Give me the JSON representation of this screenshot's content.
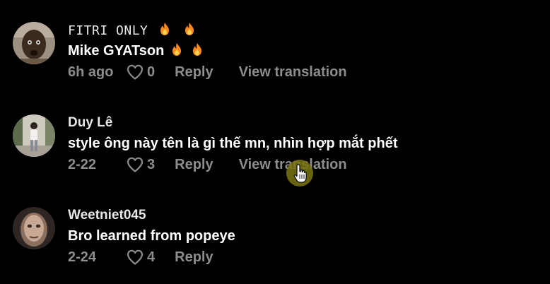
{
  "comments": [
    {
      "username": "FITRI ONLY",
      "text": "Mike GYATson",
      "date": "6h ago",
      "likes": "0",
      "reply_label": "Reply",
      "translate_label": "View translation",
      "username_emoji": [
        "fire-icon",
        "fire-icon"
      ],
      "text_emoji": [
        "fire-icon",
        "fire-icon"
      ]
    },
    {
      "username": "Duy Lê",
      "text": "style ông này tên là gì thế mn, nhìn hợp mắt phết",
      "date": "2-22",
      "likes": "3",
      "reply_label": "Reply",
      "translate_label": "View translation"
    },
    {
      "username": "Weetniet045",
      "text": "Bro learned from popeye",
      "date": "2-24",
      "likes": "4",
      "reply_label": "Reply"
    }
  ],
  "colors": {
    "background": "#000000",
    "primary_text": "#ffffff",
    "secondary_text": "#8d8d8d",
    "fire": "#ff8a1f",
    "cursor_highlight": "#7a7410"
  },
  "icons": [
    "heart-outline-icon",
    "fire-icon",
    "hand-pointer-cursor-icon"
  ]
}
